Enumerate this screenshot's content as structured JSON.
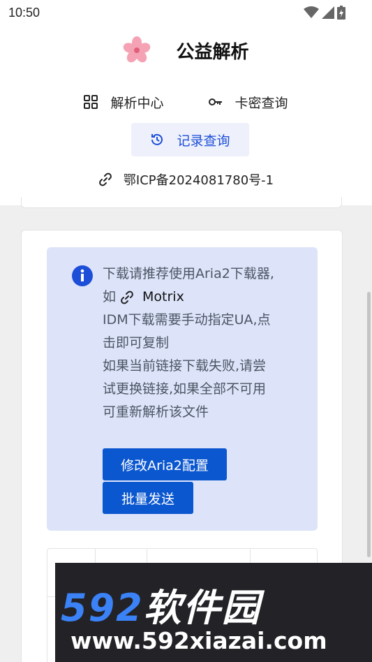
{
  "status_bar": {
    "time": "10:50",
    "icons": [
      "wifi-icon",
      "signal-icon",
      "battery-charging-icon"
    ]
  },
  "header": {
    "title": "公益解析",
    "logo_icon": "sakura-flower-icon",
    "nav": [
      {
        "label": "解析中心",
        "icon": "grid-icon"
      },
      {
        "label": "卡密查询",
        "icon": "key-icon"
      }
    ],
    "record_button": {
      "label": "记录查询",
      "icon": "history-icon"
    },
    "icp": {
      "label": "鄂ICP备2024081780号-1",
      "icon": "link-icon"
    }
  },
  "notice": {
    "icon": "info-icon",
    "line1": "下载请推荐使用Aria2下载器,",
    "line2_prefix": "如",
    "motrix_label": "Motrix",
    "line3": "IDM下载需要手动指定UA,点",
    "line4": "击即可复制",
    "line5": "如果当前链接下载失败,请尝",
    "line6": "试更换链接,如果全部不可用",
    "line7": "可重新解析该文件",
    "aria_button": "修改Aria2配置",
    "batch_button": "批量发送"
  },
  "watermark": {
    "brand_num": "592",
    "brand_cn": "软件园",
    "url": "www.592xiazai.com"
  },
  "colors": {
    "primary": "#0b57d0",
    "notice_bg": "#dde4fa",
    "record_bg": "#eef1fb"
  }
}
